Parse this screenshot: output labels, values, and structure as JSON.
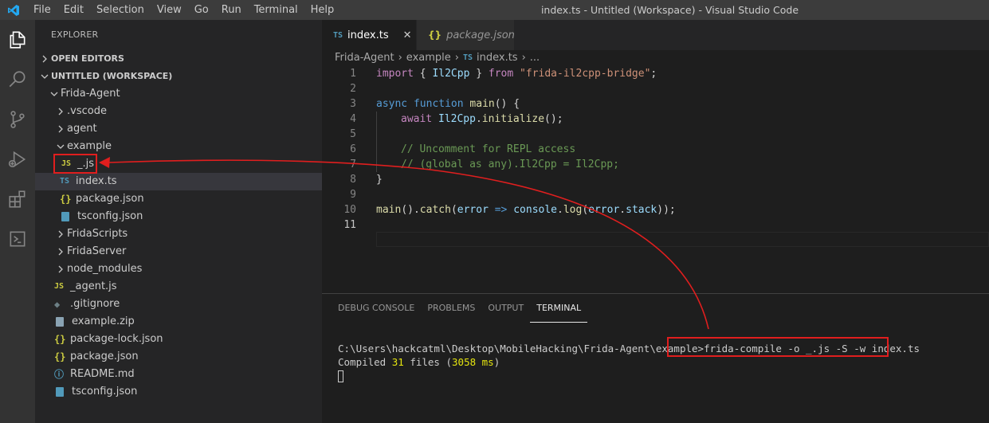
{
  "titlebar": {
    "menu": [
      "File",
      "Edit",
      "Selection",
      "View",
      "Go",
      "Run",
      "Terminal",
      "Help"
    ],
    "window_title": "index.ts - Untitled (Workspace) - Visual Studio Code"
  },
  "activitybar": {
    "icons": [
      "files-icon",
      "search-icon",
      "source-control-icon",
      "run-debug-icon",
      "extensions-icon",
      "remote-terminal-icon"
    ]
  },
  "sidebar": {
    "title": "EXPLORER",
    "open_editors": "OPEN EDITORS",
    "workspace": "UNTITLED (WORKSPACE)",
    "tree": [
      {
        "label": "Frida-Agent",
        "type": "folder-open",
        "depth": 1
      },
      {
        "label": ".vscode",
        "type": "folder",
        "depth": 2
      },
      {
        "label": "agent",
        "type": "folder",
        "depth": 2
      },
      {
        "label": "example",
        "type": "folder-open",
        "depth": 2
      },
      {
        "label": "_.js",
        "type": "js",
        "depth": 3,
        "badge": "JS"
      },
      {
        "label": "index.ts",
        "type": "ts",
        "depth": 3,
        "badge": "TS",
        "selected": true
      },
      {
        "label": "package.json",
        "type": "json",
        "depth": 3,
        "badge": "{}"
      },
      {
        "label": "tsconfig.json",
        "type": "tsconfig",
        "depth": 3
      },
      {
        "label": "FridaScripts",
        "type": "folder",
        "depth": 2
      },
      {
        "label": "FridaServer",
        "type": "folder",
        "depth": 2
      },
      {
        "label": "node_modules",
        "type": "folder",
        "depth": 2
      },
      {
        "label": "_agent.js",
        "type": "js",
        "depth": 2,
        "badge": "JS"
      },
      {
        "label": ".gitignore",
        "type": "git",
        "depth": 2,
        "badge": "◆"
      },
      {
        "label": "example.zip",
        "type": "zip",
        "depth": 2
      },
      {
        "label": "package-lock.json",
        "type": "json",
        "depth": 2,
        "badge": "{}"
      },
      {
        "label": "package.json",
        "type": "json",
        "depth": 2,
        "badge": "{}"
      },
      {
        "label": "README.md",
        "type": "info",
        "depth": 2,
        "badge": "ⓘ"
      },
      {
        "label": "tsconfig.json",
        "type": "tsconfig",
        "depth": 2
      }
    ]
  },
  "editor": {
    "tabs": [
      {
        "badge": "TS",
        "label": "index.ts",
        "close": "✕"
      },
      {
        "badge": "{}",
        "label": "package.json"
      }
    ],
    "breadcrumb": {
      "parts": [
        "Frida-Agent",
        "example"
      ],
      "file_badge": "TS",
      "file": "index.ts",
      "more": "..."
    },
    "line_numbers": [
      "1",
      "2",
      "3",
      "4",
      "5",
      "6",
      "7",
      "8",
      "9",
      "10",
      "11"
    ]
  },
  "panel": {
    "tabs": [
      "DEBUG CONSOLE",
      "PROBLEMS",
      "OUTPUT",
      "TERMINAL"
    ],
    "terminal": {
      "prompt": "C:\\Users\\hackcatml\\Desktop\\MobileHacking\\Frida-Agent\\example>",
      "command": "frida-compile -o _.js -S -w index.ts",
      "compiled_prefix": "Compiled ",
      "compiled_count": "31",
      "compiled_mid": " files (",
      "compiled_time": "3058 ms",
      "compiled_suffix": ")"
    }
  },
  "colors": {
    "annotation_red": "#e01e1e",
    "editor_bg": "#1e1e1e",
    "sidebar_bg": "#252526",
    "activity_bg": "#333333",
    "titlebar_bg": "#3c3c3c",
    "vscode_blue": "#23a9f2"
  }
}
